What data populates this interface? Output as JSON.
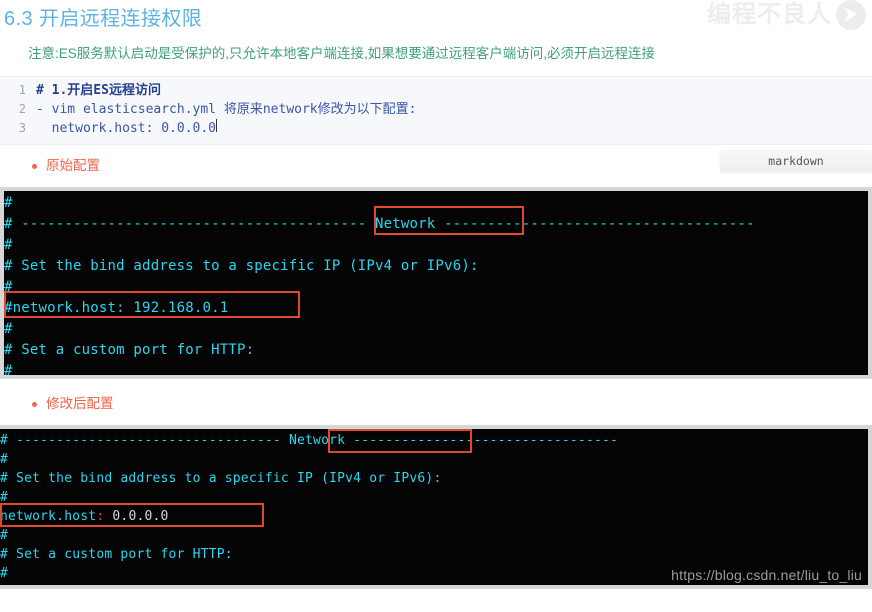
{
  "header": {
    "title": "6.3 开启远程连接权限",
    "watermark": "编程不良人",
    "logo_icon": "play-circle-icon"
  },
  "note": "注意:ES服务默认启动是受保护的,只允许本地客户端连接,如果想要通过远程客户端访问,必须开启远程连接",
  "code_block": {
    "language_tag": "markdown",
    "lines": [
      {
        "num": "1",
        "text": "# 1.开启ES远程访问",
        "bold": true
      },
      {
        "num": "2",
        "text": "- vim elasticsearch.yml 将原来network修改为以下配置:",
        "bold": false
      },
      {
        "num": "3",
        "text": "  network.host: 0.0.0.0",
        "bold": false,
        "caret": true
      }
    ]
  },
  "sections": [
    {
      "caption": "原始配置",
      "bullet_icon": "bullet-dot-icon",
      "terminal": {
        "lines": [
          "#",
          "# ---------------------------------------- Network ------------------------------------",
          "#",
          "# Set the bind address to a specific IP (IPv4 or IPv6):",
          "#",
          "#network.host: 192.168.0.1",
          "#",
          "# Set a custom port for HTTP:",
          "#"
        ],
        "highlights": [
          "Network",
          "#network.host: 192.168.0.1"
        ]
      }
    },
    {
      "caption": "修改后配置",
      "bullet_icon": "bullet-dot-icon",
      "terminal": {
        "lines_struct": [
          {
            "cyan": "# --------------------------------- Network ---------------------------------"
          },
          {
            "cyan": "#"
          },
          {
            "cyan": "# Set the bind address to a specific IP (IPv4 or IPv6):"
          },
          {
            "cyan": "#"
          },
          {
            "cyan": "network.host",
            "red": ":",
            "white": " 0.0.0.0"
          },
          {
            "cyan": "#"
          },
          {
            "cyan": "# Set a custom port for HTTP:"
          },
          {
            "cyan": "#"
          }
        ],
        "highlights": [
          "Network",
          "network.host: 0.0.0.0"
        ]
      }
    }
  ],
  "footer": {
    "watermark_url": "https://blog.csdn.net/liu_to_liu"
  },
  "colors": {
    "title": "#5cb3e4",
    "note": "#41a07a",
    "caption": "#f2634a",
    "terminal_bg": "#040404",
    "terminal_text": "#2ad6f0",
    "highlight_border": "#e1472a",
    "code_text": "#3956a8"
  }
}
